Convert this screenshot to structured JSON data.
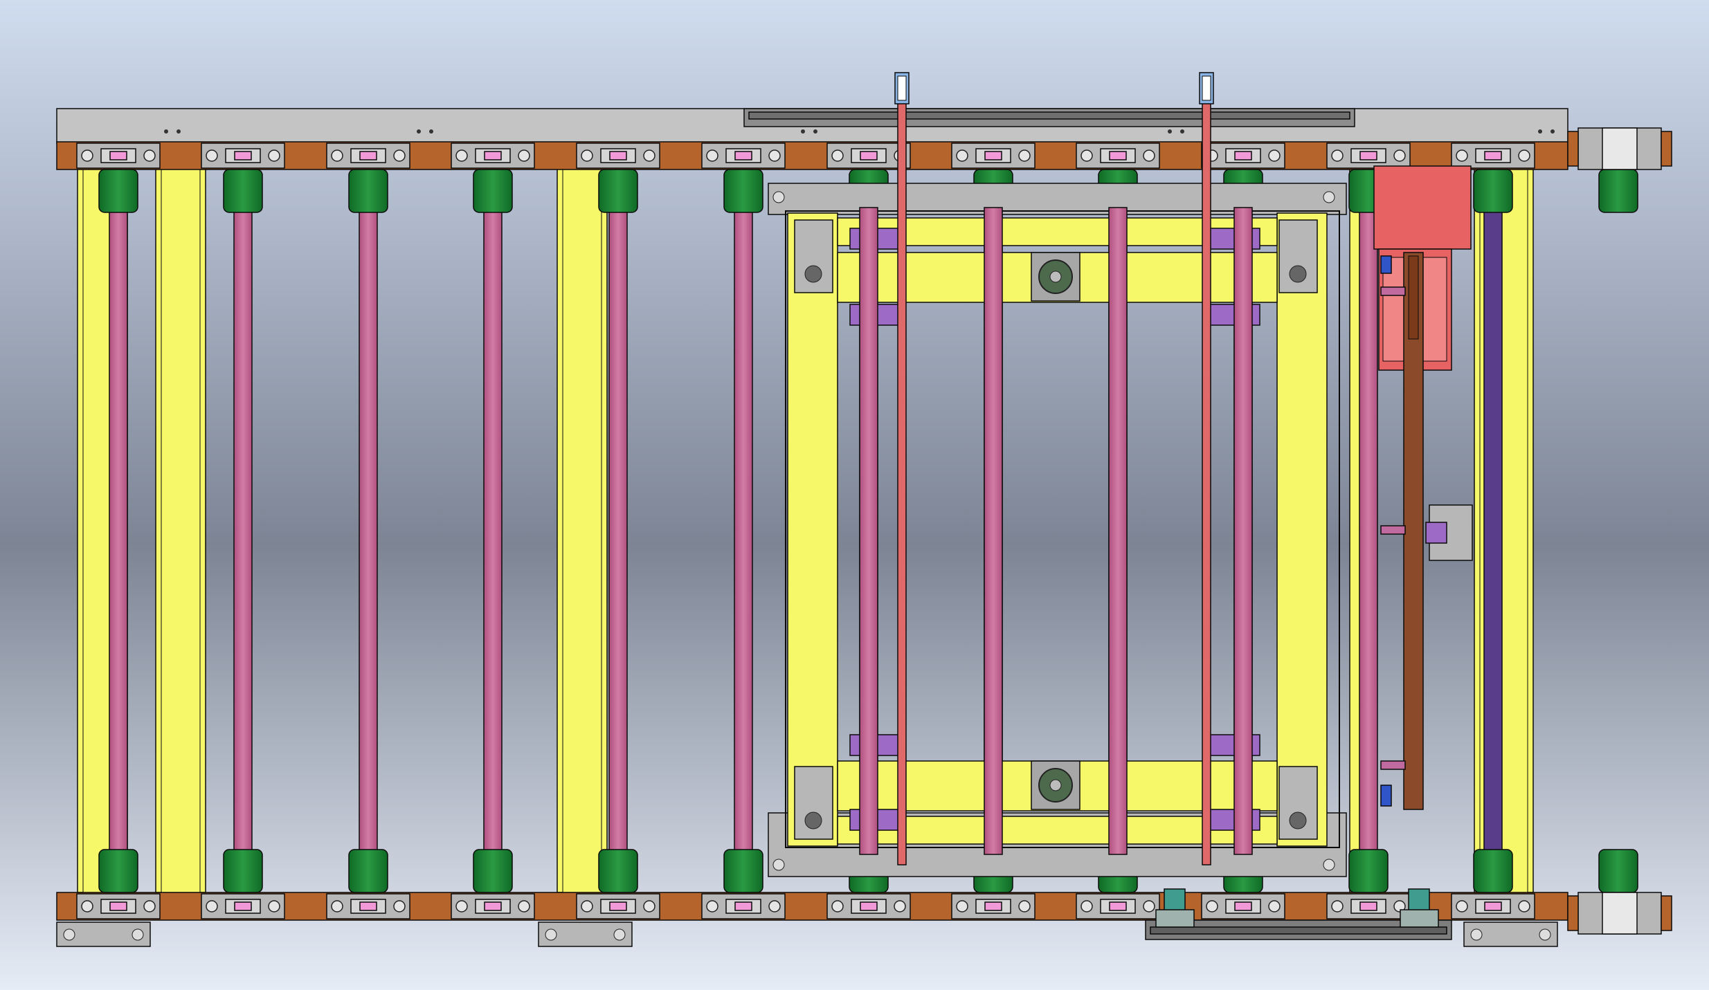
{
  "view": {
    "kind": "CAD assembly model, top view",
    "background": {
      "top": "#d0dcef",
      "middle": "#7d8595",
      "bottom": "#e6ecf6"
    }
  },
  "colors": {
    "frame_outline": "#0a0a0a",
    "yellow_frame": "#f7f76a",
    "yellow_frame_shade": "#dcdc4e",
    "brown_rail": "#b5642b",
    "grey_rail": "#9a9a9a",
    "grey_rail_top": "#c4c4c4",
    "green_sprocket": "#0f6a25",
    "green_sprocket_light": "#2a9a44",
    "pink_roller": "#b0507f",
    "pink_roller_light": "#d27ca6",
    "purple_bracket": "#9d6bc6",
    "grey_block": "#b7b7b7",
    "red_motor": "#e76363",
    "red_pin": "#e06a6a",
    "blue_sensor": "#8ab4e6",
    "dark_roller": "#5a3d8a",
    "brown_bar": "#8b4a2a",
    "teal_clip": "#3f9c8f",
    "blue_part": "#2f55c8"
  },
  "components": {
    "roller_count": 12,
    "sprocket_count": 12,
    "lift_table_count": 1,
    "sensor_count": 2,
    "motor_count": 1
  },
  "labels": []
}
